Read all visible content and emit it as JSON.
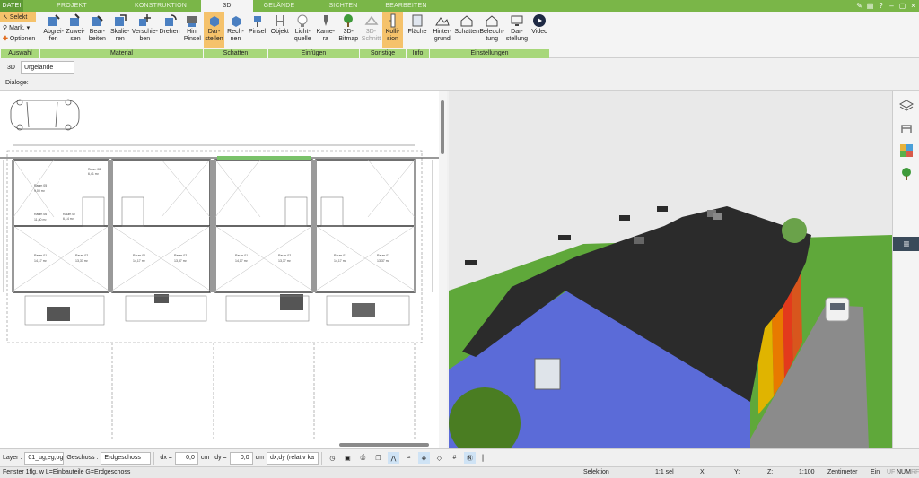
{
  "tabs": [
    {
      "label": "DATEI",
      "active": false
    },
    {
      "label": "PROJEKT",
      "active": false
    },
    {
      "label": "KONSTRUKTION",
      "active": false
    },
    {
      "label": "3D",
      "active": true
    },
    {
      "label": "GELÄNDE",
      "active": false
    },
    {
      "label": "SICHTEN",
      "active": false
    },
    {
      "label": "BEARBEITEN",
      "active": false
    }
  ],
  "ribbon": {
    "auswahl": {
      "label": "Auswahl",
      "items": [
        "Selekt",
        "Mark.",
        "Optionen"
      ]
    },
    "material": {
      "label": "Material",
      "buttons": [
        [
          "Abgrei-",
          "fen"
        ],
        [
          "Zuwei-",
          "sen"
        ],
        [
          "Bear-",
          "beiten"
        ],
        [
          "Skalie-",
          "ren"
        ],
        [
          "Verschie-",
          "ben"
        ],
        [
          "Drehen",
          ""
        ],
        [
          "Hin.",
          "Pinsel"
        ]
      ]
    },
    "schatten": {
      "label": "Schatten",
      "buttons": [
        [
          "Dar-",
          "stellen"
        ],
        [
          "Rech-",
          "nen"
        ],
        [
          "Pinsel",
          ""
        ]
      ]
    },
    "einfuegen": {
      "label": "Einfügen",
      "buttons": [
        [
          "Objekt",
          ""
        ],
        [
          "Licht-",
          "quelle"
        ],
        [
          "Kame-",
          "ra"
        ],
        [
          "3D-",
          "Bitmap"
        ]
      ]
    },
    "sonstige": {
      "label": "Sonstige",
      "buttons": [
        [
          "3D-",
          "Schnitt"
        ],
        [
          "Kolli-",
          "sion"
        ]
      ]
    },
    "info": {
      "label": "Info",
      "buttons": [
        [
          "Fläche",
          ""
        ]
      ]
    },
    "einstellungen": {
      "label": "Einstellungen",
      "buttons": [
        [
          "Hinter-",
          "grund"
        ],
        [
          "Schatten",
          ""
        ],
        [
          "Beleuch-",
          "tung"
        ],
        [
          "Dar-",
          "stellung"
        ],
        [
          "Video",
          ""
        ]
      ]
    }
  },
  "bar2": {
    "mode": "3D",
    "combo": "Urgelände"
  },
  "bar3": {
    "label": "Dialoge:"
  },
  "bottom": {
    "layer_label": "Layer :",
    "layer_value": "01_ug,eg,og",
    "geschoss_label": "Geschoss :",
    "geschoss_value": "Erdgeschoss",
    "dx_label": "dx =",
    "dx_value": "0,0",
    "dy_label": "dy =",
    "dy_value": "0,0",
    "unit": "cm",
    "mode_value": "dx,dy (relativ ka"
  },
  "status": {
    "hint": "Fenster 1flg. w L=Einbauteile G=Erdgeschoss",
    "selection": "Selektion",
    "count": "1:1 sel",
    "x": "X:",
    "y": "Y:",
    "z": "Z:",
    "scale": "1:100",
    "unit": "Zentimeter",
    "ein": "Ein",
    "uf": "UF",
    "num": "NUM",
    "rf": "RF"
  },
  "plan_rooms": [
    {
      "name": "Raum 05",
      "area": "9,00 m²"
    },
    {
      "name": "Raum 06",
      "area": "11,80 m²"
    },
    {
      "name": "Raum 07",
      "area": "6,14 m²"
    },
    {
      "name": "Raum 08",
      "area": "6,41 m²"
    },
    {
      "name": "Raum 01",
      "area": "14,17 m²"
    },
    {
      "name": "Raum 02",
      "area": "13,37 m²"
    }
  ],
  "colors": {
    "accent_green": "#7ab648",
    "group_label": "#a7d77a",
    "selected": "#f5c26b",
    "roof": "#2b2b2b",
    "wall": "#5b6bd8",
    "sky": "#e9e9e9",
    "grass": "#5fa83a"
  }
}
